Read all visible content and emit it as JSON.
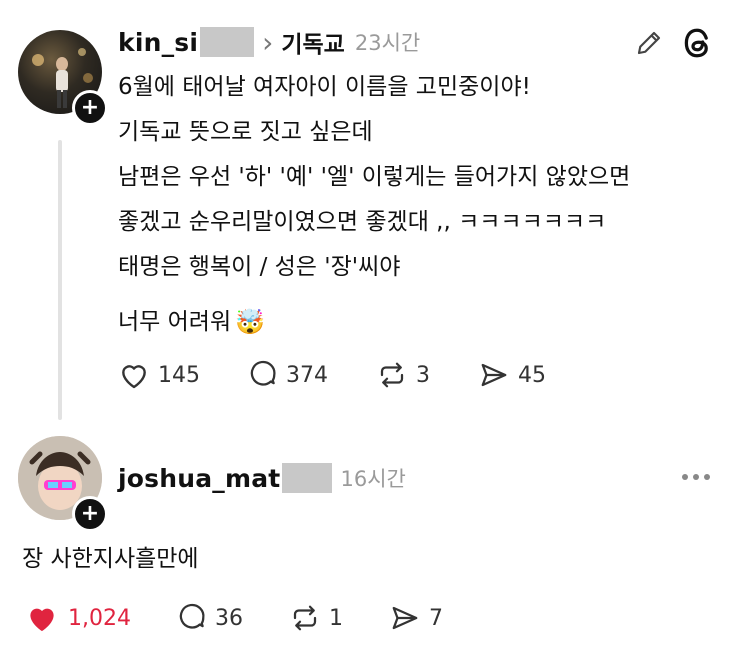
{
  "post": {
    "username": "kin_si",
    "topic_arrow": "›",
    "topic": "기독교",
    "time": "23시간",
    "lines": [
      "6월에 태어날 여자아이 이름을 고민중이야!",
      "기독교 뜻으로 짓고 싶은데",
      "남편은 우선 '하' '예' '엘' 이렇게는 들어가지 않았으면",
      "좋겠고 순우리말이였으면 좋겠대 ,,  ㅋㅋㅋㅋㅋㅋㅋ",
      "태명은 행복이 / 성은 '장'씨야",
      "너무 어려워"
    ],
    "emoji": "🤯",
    "likes": "145",
    "comments": "374",
    "reposts": "3",
    "shares": "45"
  },
  "reply": {
    "username": "joshua_mat",
    "time": "16시간",
    "text": "장 사한지사흘만에",
    "likes": "1,024",
    "comments": "36",
    "reposts": "1",
    "shares": "7",
    "like_color": "#e0243f"
  },
  "icons": {
    "edit": "pencil-icon",
    "app": "threads-logo-icon",
    "more": "more-dots-icon",
    "like": "heart-icon",
    "comment": "comment-bubble-icon",
    "repost": "repost-icon",
    "share": "send-icon",
    "follow": "plus-icon"
  }
}
